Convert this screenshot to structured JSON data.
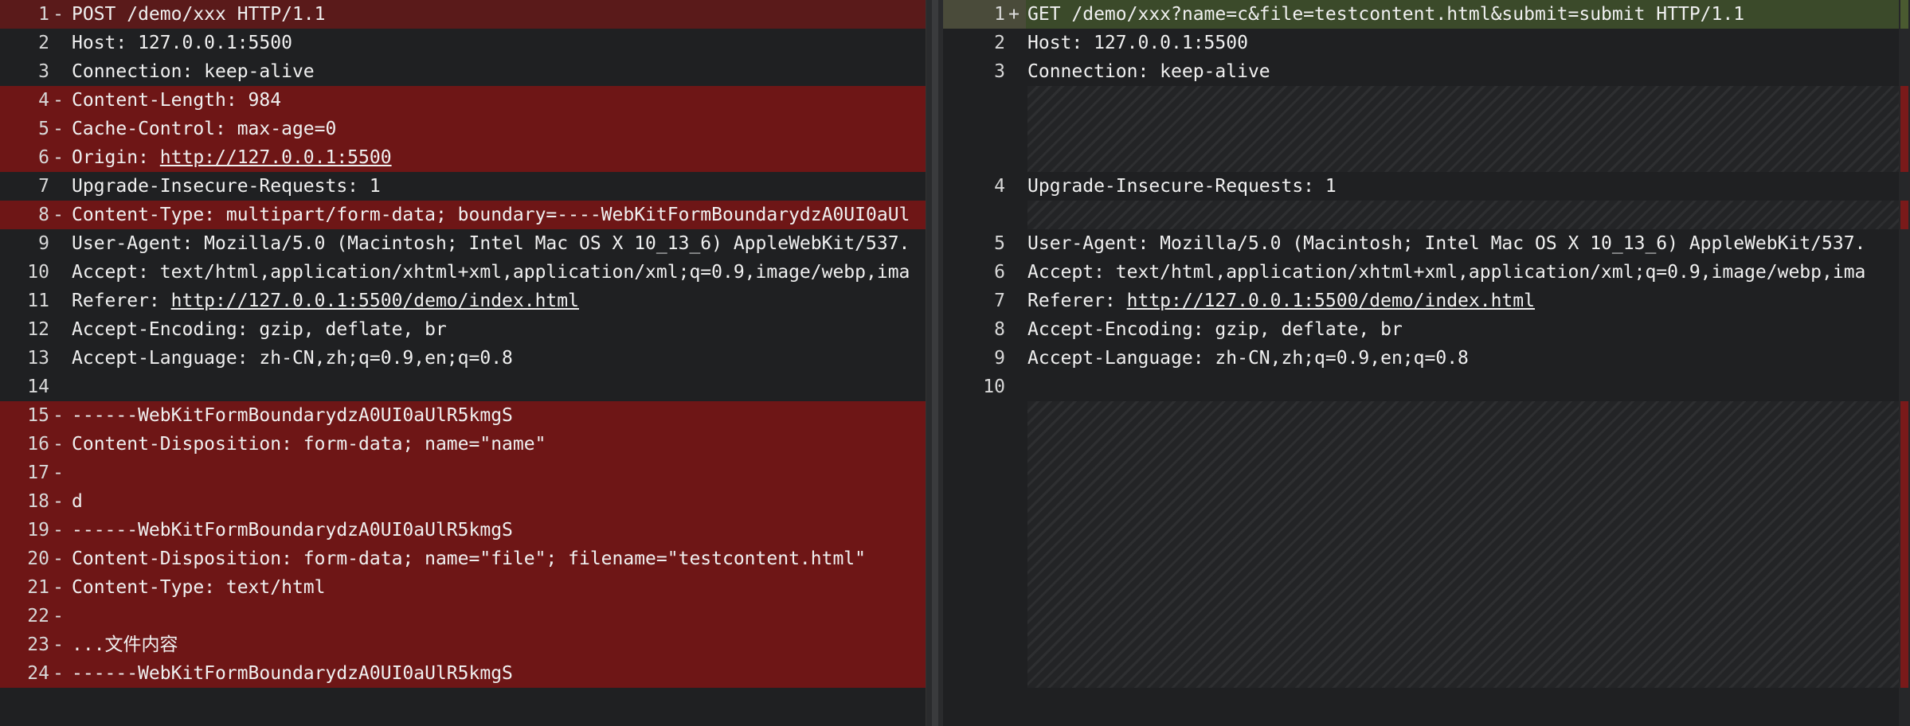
{
  "left": {
    "lines": [
      {
        "num": "1",
        "mark": "-",
        "text": "POST /demo/xxx HTTP/1.1"
      },
      {
        "num": "2",
        "mark": "",
        "text": "Host: 127.0.0.1:5500"
      },
      {
        "num": "3",
        "mark": "",
        "text": "Connection: keep-alive"
      },
      {
        "num": "4",
        "mark": "-",
        "text": "Content-Length: 984"
      },
      {
        "num": "5",
        "mark": "-",
        "text": "Cache-Control: max-age=0"
      },
      {
        "num": "6",
        "mark": "-",
        "text": "Origin: ",
        "link": "http://127.0.0.1:5500"
      },
      {
        "num": "7",
        "mark": "",
        "text": "Upgrade-Insecure-Requests: 1"
      },
      {
        "num": "8",
        "mark": "-",
        "text": "Content-Type: multipart/form-data; boundary=----WebKitFormBoundarydzA0UI0aUl"
      },
      {
        "num": "9",
        "mark": "",
        "text": "User-Agent: Mozilla/5.0 (Macintosh; Intel Mac OS X 10_13_6) AppleWebKit/537."
      },
      {
        "num": "10",
        "mark": "",
        "text": "Accept: text/html,application/xhtml+xml,application/xml;q=0.9,image/webp,ima"
      },
      {
        "num": "11",
        "mark": "",
        "text": "Referer: ",
        "link": "http://127.0.0.1:5500/demo/index.html"
      },
      {
        "num": "12",
        "mark": "",
        "text": "Accept-Encoding: gzip, deflate, br"
      },
      {
        "num": "13",
        "mark": "",
        "text": "Accept-Language: zh-CN,zh;q=0.9,en;q=0.8"
      },
      {
        "num": "14",
        "mark": "",
        "text": ""
      },
      {
        "num": "15",
        "mark": "-",
        "text": "------WebKitFormBoundarydzA0UI0aUlR5kmgS"
      },
      {
        "num": "16",
        "mark": "-",
        "text": "Content-Disposition: form-data; name=\"name\""
      },
      {
        "num": "17",
        "mark": "-",
        "text": ""
      },
      {
        "num": "18",
        "mark": "-",
        "text": "d"
      },
      {
        "num": "19",
        "mark": "-",
        "text": "------WebKitFormBoundarydzA0UI0aUlR5kmgS"
      },
      {
        "num": "20",
        "mark": "-",
        "text": "Content-Disposition: form-data; name=\"file\"; filename=\"testcontent.html\""
      },
      {
        "num": "21",
        "mark": "-",
        "text": "Content-Type: text/html"
      },
      {
        "num": "22",
        "mark": "-",
        "text": ""
      },
      {
        "num": "23",
        "mark": "-",
        "text": "...文件内容"
      },
      {
        "num": "24",
        "mark": "-",
        "text": "------WebKitFormBoundarydzA0UI0aUlR5kmgS"
      }
    ]
  },
  "right": {
    "lines": [
      {
        "num": "1",
        "mark": "+",
        "text": "GET /demo/xxx?name=c&file=testcontent.html&submit=submit HTTP/1.1"
      },
      {
        "num": "2",
        "mark": "",
        "text": "Host: 127.0.0.1:5500"
      },
      {
        "num": "3",
        "mark": "",
        "text": "Connection: keep-alive"
      },
      {
        "num": "4",
        "mark": "",
        "text": "Upgrade-Insecure-Requests: 1"
      },
      {
        "num": "5",
        "mark": "",
        "text": "User-Agent: Mozilla/5.0 (Macintosh; Intel Mac OS X 10_13_6) AppleWebKit/537."
      },
      {
        "num": "6",
        "mark": "",
        "text": "Accept: text/html,application/xhtml+xml,application/xml;q=0.9,image/webp,ima"
      },
      {
        "num": "7",
        "mark": "",
        "text": "Referer: ",
        "link": "http://127.0.0.1:5500/demo/index.html"
      },
      {
        "num": "8",
        "mark": "",
        "text": "Accept-Encoding: gzip, deflate, br"
      },
      {
        "num": "9",
        "mark": "",
        "text": "Accept-Language: zh-CN,zh;q=0.9,en;q=0.8"
      },
      {
        "num": "10",
        "mark": "",
        "text": ""
      }
    ]
  },
  "colors": {
    "removed": "#6e1616",
    "added": "#3b4a2a",
    "background": "#1f2022"
  }
}
